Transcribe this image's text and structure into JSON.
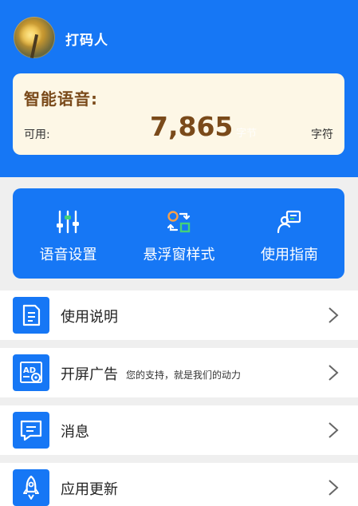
{
  "user": {
    "name": "打码人"
  },
  "quota": {
    "title": "智能语音:",
    "available_label": "可用:",
    "value": "7,865",
    "ghost_text": "字节",
    "unit": "字符"
  },
  "quick_actions": [
    {
      "label": "语音设置",
      "icon": "sliders-icon"
    },
    {
      "label": "悬浮窗样式",
      "icon": "switch-style-icon"
    },
    {
      "label": "使用指南",
      "icon": "guide-icon"
    }
  ],
  "menu": [
    {
      "label": "使用说明",
      "icon": "document-icon"
    },
    {
      "label": "开屏广告",
      "subtitle": "您的支持，就是我们的动力",
      "icon": "ad-settings-icon"
    },
    {
      "label": "消息",
      "icon": "message-icon"
    },
    {
      "label": "应用更新",
      "icon": "rocket-icon"
    }
  ],
  "colors": {
    "primary": "#1677f5",
    "card_bg": "#fdf7e6",
    "quota_text": "#7a4a1a",
    "page_bg": "#efefef"
  }
}
